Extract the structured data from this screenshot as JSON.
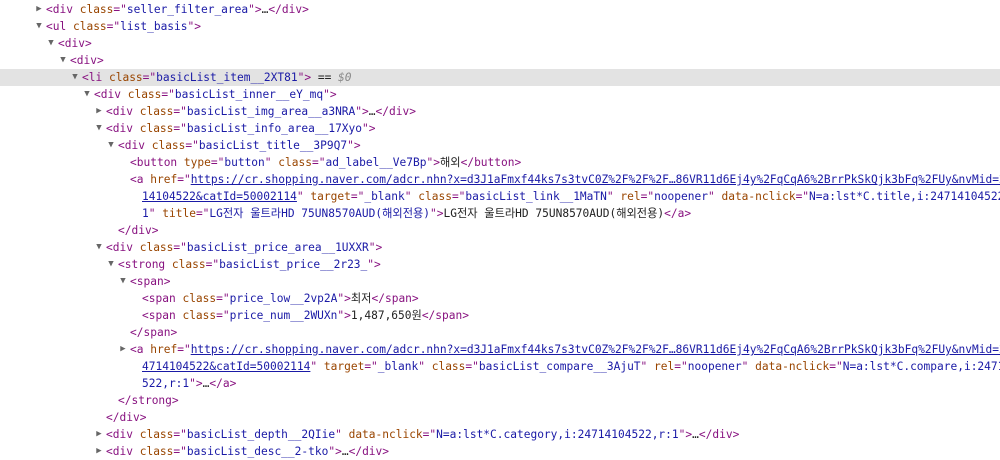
{
  "rows": [
    {
      "indent": 2,
      "arrow": "right",
      "parts": [
        {
          "t": "p",
          "s": "<"
        },
        {
          "t": "t",
          "s": "div"
        },
        {
          "t": "txt",
          "s": " "
        },
        {
          "t": "a",
          "s": "class"
        },
        {
          "t": "p",
          "s": "=\""
        },
        {
          "t": "v",
          "s": "seller_filter_area"
        },
        {
          "t": "p",
          "s": "\">"
        },
        {
          "t": "ell",
          "s": "…"
        },
        {
          "t": "p",
          "s": "</"
        },
        {
          "t": "t",
          "s": "div"
        },
        {
          "t": "p",
          "s": ">"
        }
      ]
    },
    {
      "indent": 2,
      "arrow": "down",
      "parts": [
        {
          "t": "p",
          "s": "<"
        },
        {
          "t": "t",
          "s": "ul"
        },
        {
          "t": "txt",
          "s": " "
        },
        {
          "t": "a",
          "s": "class"
        },
        {
          "t": "p",
          "s": "=\""
        },
        {
          "t": "v",
          "s": "list_basis"
        },
        {
          "t": "p",
          "s": "\">"
        }
      ]
    },
    {
      "indent": 3,
      "arrow": "down",
      "parts": [
        {
          "t": "p",
          "s": "<"
        },
        {
          "t": "t",
          "s": "div"
        },
        {
          "t": "p",
          "s": ">"
        }
      ]
    },
    {
      "indent": 4,
      "arrow": "down",
      "parts": [
        {
          "t": "p",
          "s": "<"
        },
        {
          "t": "t",
          "s": "div"
        },
        {
          "t": "p",
          "s": ">"
        }
      ]
    },
    {
      "indent": 5,
      "arrow": "down",
      "selected": true,
      "parts": [
        {
          "t": "p",
          "s": "<"
        },
        {
          "t": "t",
          "s": "li"
        },
        {
          "t": "txt",
          "s": " "
        },
        {
          "t": "a",
          "s": "class"
        },
        {
          "t": "p",
          "s": "=\""
        },
        {
          "t": "v",
          "s": "basicList_item__2XT81"
        },
        {
          "t": "p",
          "s": "\">"
        },
        {
          "t": "txt",
          "s": " == "
        },
        {
          "t": "dollar",
          "s": "$0"
        }
      ]
    },
    {
      "indent": 6,
      "arrow": "down",
      "parts": [
        {
          "t": "p",
          "s": "<"
        },
        {
          "t": "t",
          "s": "div"
        },
        {
          "t": "txt",
          "s": " "
        },
        {
          "t": "a",
          "s": "class"
        },
        {
          "t": "p",
          "s": "=\""
        },
        {
          "t": "v",
          "s": "basicList_inner__eY_mq"
        },
        {
          "t": "p",
          "s": "\">"
        }
      ]
    },
    {
      "indent": 7,
      "arrow": "right",
      "parts": [
        {
          "t": "p",
          "s": "<"
        },
        {
          "t": "t",
          "s": "div"
        },
        {
          "t": "txt",
          "s": " "
        },
        {
          "t": "a",
          "s": "class"
        },
        {
          "t": "p",
          "s": "=\""
        },
        {
          "t": "v",
          "s": "basicList_img_area__a3NRA"
        },
        {
          "t": "p",
          "s": "\">"
        },
        {
          "t": "ell",
          "s": "…"
        },
        {
          "t": "p",
          "s": "</"
        },
        {
          "t": "t",
          "s": "div"
        },
        {
          "t": "p",
          "s": ">"
        }
      ]
    },
    {
      "indent": 7,
      "arrow": "down",
      "parts": [
        {
          "t": "p",
          "s": "<"
        },
        {
          "t": "t",
          "s": "div"
        },
        {
          "t": "txt",
          "s": " "
        },
        {
          "t": "a",
          "s": "class"
        },
        {
          "t": "p",
          "s": "=\""
        },
        {
          "t": "v",
          "s": "basicList_info_area__17Xyo"
        },
        {
          "t": "p",
          "s": "\">"
        }
      ]
    },
    {
      "indent": 8,
      "arrow": "down",
      "parts": [
        {
          "t": "p",
          "s": "<"
        },
        {
          "t": "t",
          "s": "div"
        },
        {
          "t": "txt",
          "s": " "
        },
        {
          "t": "a",
          "s": "class"
        },
        {
          "t": "p",
          "s": "=\""
        },
        {
          "t": "v",
          "s": "basicList_title__3P9Q7"
        },
        {
          "t": "p",
          "s": "\">"
        }
      ]
    },
    {
      "indent": 9,
      "arrow": "",
      "parts": [
        {
          "t": "p",
          "s": "<"
        },
        {
          "t": "t",
          "s": "button"
        },
        {
          "t": "txt",
          "s": " "
        },
        {
          "t": "a",
          "s": "type"
        },
        {
          "t": "p",
          "s": "=\""
        },
        {
          "t": "v",
          "s": "button"
        },
        {
          "t": "p",
          "s": "\""
        },
        {
          "t": "txt",
          "s": " "
        },
        {
          "t": "a",
          "s": "class"
        },
        {
          "t": "p",
          "s": "=\""
        },
        {
          "t": "v",
          "s": "ad_label__Ve7Bp"
        },
        {
          "t": "p",
          "s": "\">"
        },
        {
          "t": "txt",
          "s": "해외"
        },
        {
          "t": "p",
          "s": "</"
        },
        {
          "t": "t",
          "s": "button"
        },
        {
          "t": "p",
          "s": ">"
        }
      ]
    },
    {
      "indent": 9,
      "arrow": "",
      "parts": [
        {
          "t": "p",
          "s": "<"
        },
        {
          "t": "t",
          "s": "a"
        },
        {
          "t": "txt",
          "s": " "
        },
        {
          "t": "a",
          "s": "href"
        },
        {
          "t": "p",
          "s": "=\""
        },
        {
          "t": "lnk",
          "s": "https://cr.shopping.naver.com/adcr.nhn?x=d3J1aFmxf44ks7s3tvC0Z%2F%2F%2F…86VR11d6Ej4y%2FqCqA6%2BrrPkSkQjk3bFq%2FUy&nvMid=247"
        }
      ]
    },
    {
      "indent": 10,
      "arrow": "",
      "parts": [
        {
          "t": "lnk",
          "s": "14104522&catId=50002114"
        },
        {
          "t": "p",
          "s": "\""
        },
        {
          "t": "txt",
          "s": " "
        },
        {
          "t": "a",
          "s": "target"
        },
        {
          "t": "p",
          "s": "=\""
        },
        {
          "t": "v",
          "s": "_blank"
        },
        {
          "t": "p",
          "s": "\""
        },
        {
          "t": "txt",
          "s": " "
        },
        {
          "t": "a",
          "s": "class"
        },
        {
          "t": "p",
          "s": "=\""
        },
        {
          "t": "v",
          "s": "basicList_link__1MaTN"
        },
        {
          "t": "p",
          "s": "\""
        },
        {
          "t": "txt",
          "s": " "
        },
        {
          "t": "a",
          "s": "rel"
        },
        {
          "t": "p",
          "s": "=\""
        },
        {
          "t": "v",
          "s": "noopener"
        },
        {
          "t": "p",
          "s": "\""
        },
        {
          "t": "txt",
          "s": " "
        },
        {
          "t": "a",
          "s": "data-nclick"
        },
        {
          "t": "p",
          "s": "=\""
        },
        {
          "t": "v",
          "s": "N=a:lst*C.title,i:24714104522,r:"
        }
      ]
    },
    {
      "indent": 10,
      "arrow": "",
      "parts": [
        {
          "t": "v",
          "s": "1"
        },
        {
          "t": "p",
          "s": "\""
        },
        {
          "t": "txt",
          "s": " "
        },
        {
          "t": "a",
          "s": "title"
        },
        {
          "t": "p",
          "s": "=\""
        },
        {
          "t": "v",
          "s": "LG전자 울트라HD 75UN8570AUD(해외전용)"
        },
        {
          "t": "p",
          "s": "\">"
        },
        {
          "t": "txt",
          "s": "LG전자 울트라HD 75UN8570AUD(해외전용)"
        },
        {
          "t": "p",
          "s": "</"
        },
        {
          "t": "t",
          "s": "a"
        },
        {
          "t": "p",
          "s": ">"
        }
      ]
    },
    {
      "indent": 8,
      "arrow": "",
      "parts": [
        {
          "t": "p",
          "s": "</"
        },
        {
          "t": "t",
          "s": "div"
        },
        {
          "t": "p",
          "s": ">"
        }
      ]
    },
    {
      "indent": 7,
      "arrow": "down",
      "parts": [
        {
          "t": "p",
          "s": "<"
        },
        {
          "t": "t",
          "s": "div"
        },
        {
          "t": "txt",
          "s": " "
        },
        {
          "t": "a",
          "s": "class"
        },
        {
          "t": "p",
          "s": "=\""
        },
        {
          "t": "v",
          "s": "basicList_price_area__1UXXR"
        },
        {
          "t": "p",
          "s": "\">"
        }
      ]
    },
    {
      "indent": 8,
      "arrow": "down",
      "parts": [
        {
          "t": "p",
          "s": "<"
        },
        {
          "t": "t",
          "s": "strong"
        },
        {
          "t": "txt",
          "s": " "
        },
        {
          "t": "a",
          "s": "class"
        },
        {
          "t": "p",
          "s": "=\""
        },
        {
          "t": "v",
          "s": "basicList_price__2r23_"
        },
        {
          "t": "p",
          "s": "\">"
        }
      ]
    },
    {
      "indent": 9,
      "arrow": "down",
      "parts": [
        {
          "t": "p",
          "s": "<"
        },
        {
          "t": "t",
          "s": "span"
        },
        {
          "t": "p",
          "s": ">"
        }
      ]
    },
    {
      "indent": 10,
      "arrow": "",
      "parts": [
        {
          "t": "p",
          "s": "<"
        },
        {
          "t": "t",
          "s": "span"
        },
        {
          "t": "txt",
          "s": " "
        },
        {
          "t": "a",
          "s": "class"
        },
        {
          "t": "p",
          "s": "=\""
        },
        {
          "t": "v",
          "s": "price_low__2vp2A"
        },
        {
          "t": "p",
          "s": "\">"
        },
        {
          "t": "txt",
          "s": "최저"
        },
        {
          "t": "p",
          "s": "</"
        },
        {
          "t": "t",
          "s": "span"
        },
        {
          "t": "p",
          "s": ">"
        }
      ]
    },
    {
      "indent": 10,
      "arrow": "",
      "parts": [
        {
          "t": "p",
          "s": "<"
        },
        {
          "t": "t",
          "s": "span"
        },
        {
          "t": "txt",
          "s": " "
        },
        {
          "t": "a",
          "s": "class"
        },
        {
          "t": "p",
          "s": "=\""
        },
        {
          "t": "v",
          "s": "price_num__2WUXn"
        },
        {
          "t": "p",
          "s": "\">"
        },
        {
          "t": "txt",
          "s": "1,487,650원"
        },
        {
          "t": "p",
          "s": "</"
        },
        {
          "t": "t",
          "s": "span"
        },
        {
          "t": "p",
          "s": ">"
        }
      ]
    },
    {
      "indent": 9,
      "arrow": "",
      "parts": [
        {
          "t": "p",
          "s": "</"
        },
        {
          "t": "t",
          "s": "span"
        },
        {
          "t": "p",
          "s": ">"
        }
      ]
    },
    {
      "indent": 9,
      "arrow": "right",
      "parts": [
        {
          "t": "p",
          "s": "<"
        },
        {
          "t": "t",
          "s": "a"
        },
        {
          "t": "txt",
          "s": " "
        },
        {
          "t": "a",
          "s": "href"
        },
        {
          "t": "p",
          "s": "=\""
        },
        {
          "t": "lnk",
          "s": "https://cr.shopping.naver.com/adcr.nhn?x=d3J1aFmxf44ks7s3tvC0Z%2F%2F%2F…86VR11d6Ej4y%2FqCqA6%2BrrPkSkQjk3bFq%2FUy&nvMid=2"
        }
      ]
    },
    {
      "indent": 10,
      "arrow": "",
      "parts": [
        {
          "t": "lnk",
          "s": "4714104522&catId=50002114"
        },
        {
          "t": "p",
          "s": "\""
        },
        {
          "t": "txt",
          "s": " "
        },
        {
          "t": "a",
          "s": "target"
        },
        {
          "t": "p",
          "s": "=\""
        },
        {
          "t": "v",
          "s": "_blank"
        },
        {
          "t": "p",
          "s": "\""
        },
        {
          "t": "txt",
          "s": " "
        },
        {
          "t": "a",
          "s": "class"
        },
        {
          "t": "p",
          "s": "=\""
        },
        {
          "t": "v",
          "s": "basicList_compare__3AjuT"
        },
        {
          "t": "p",
          "s": "\""
        },
        {
          "t": "txt",
          "s": " "
        },
        {
          "t": "a",
          "s": "rel"
        },
        {
          "t": "p",
          "s": "=\""
        },
        {
          "t": "v",
          "s": "noopener"
        },
        {
          "t": "p",
          "s": "\""
        },
        {
          "t": "txt",
          "s": " "
        },
        {
          "t": "a",
          "s": "data-nclick"
        },
        {
          "t": "p",
          "s": "=\""
        },
        {
          "t": "v",
          "s": "N=a:lst*C.compare,i:24714104"
        }
      ]
    },
    {
      "indent": 10,
      "arrow": "",
      "parts": [
        {
          "t": "v",
          "s": "522,r:1"
        },
        {
          "t": "p",
          "s": "\">"
        },
        {
          "t": "ell",
          "s": "…"
        },
        {
          "t": "p",
          "s": "</"
        },
        {
          "t": "t",
          "s": "a"
        },
        {
          "t": "p",
          "s": ">"
        }
      ]
    },
    {
      "indent": 8,
      "arrow": "",
      "parts": [
        {
          "t": "p",
          "s": "</"
        },
        {
          "t": "t",
          "s": "strong"
        },
        {
          "t": "p",
          "s": ">"
        }
      ]
    },
    {
      "indent": 7,
      "arrow": "",
      "parts": [
        {
          "t": "p",
          "s": "</"
        },
        {
          "t": "t",
          "s": "div"
        },
        {
          "t": "p",
          "s": ">"
        }
      ]
    },
    {
      "indent": 7,
      "arrow": "right",
      "parts": [
        {
          "t": "p",
          "s": "<"
        },
        {
          "t": "t",
          "s": "div"
        },
        {
          "t": "txt",
          "s": " "
        },
        {
          "t": "a",
          "s": "class"
        },
        {
          "t": "p",
          "s": "=\""
        },
        {
          "t": "v",
          "s": "basicList_depth__2QIie"
        },
        {
          "t": "p",
          "s": "\""
        },
        {
          "t": "txt",
          "s": " "
        },
        {
          "t": "a",
          "s": "data-nclick"
        },
        {
          "t": "p",
          "s": "=\""
        },
        {
          "t": "v",
          "s": "N=a:lst*C.category,i:24714104522,r:1"
        },
        {
          "t": "p",
          "s": "\">"
        },
        {
          "t": "ell",
          "s": "…"
        },
        {
          "t": "p",
          "s": "</"
        },
        {
          "t": "t",
          "s": "div"
        },
        {
          "t": "p",
          "s": ">"
        }
      ]
    },
    {
      "indent": 7,
      "arrow": "right",
      "parts": [
        {
          "t": "p",
          "s": "<"
        },
        {
          "t": "t",
          "s": "div"
        },
        {
          "t": "txt",
          "s": " "
        },
        {
          "t": "a",
          "s": "class"
        },
        {
          "t": "p",
          "s": "=\""
        },
        {
          "t": "v",
          "s": "basicList_desc__2-tko"
        },
        {
          "t": "p",
          "s": "\">"
        },
        {
          "t": "ell",
          "s": "…"
        },
        {
          "t": "p",
          "s": "</"
        },
        {
          "t": "t",
          "s": "div"
        },
        {
          "t": "p",
          "s": ">"
        }
      ]
    }
  ],
  "icons": {
    "expand": "triangle-right-icon",
    "collapse": "triangle-down-icon"
  }
}
